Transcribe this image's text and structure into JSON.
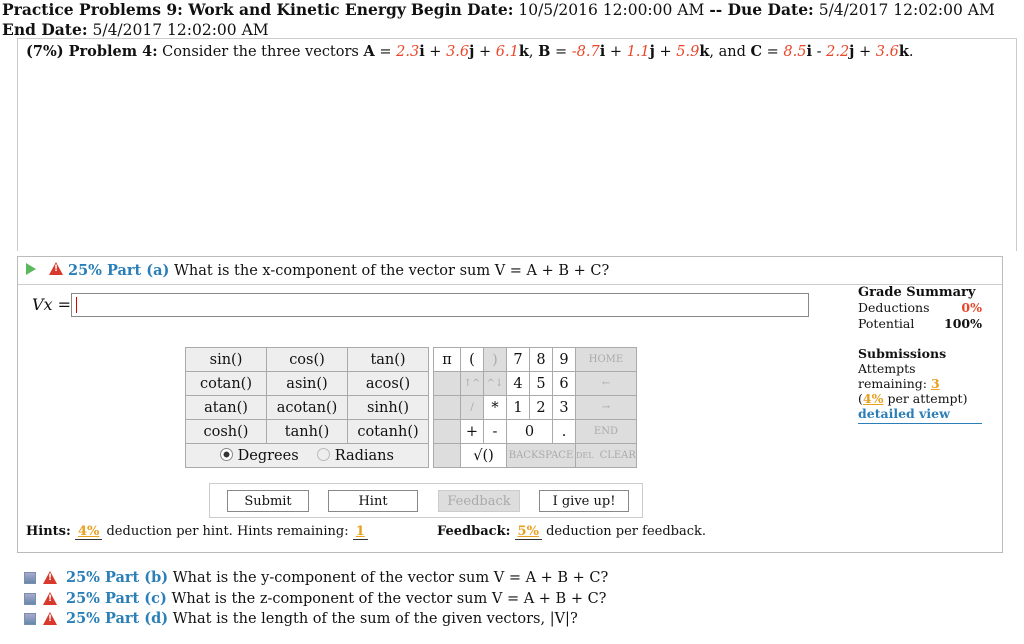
{
  "header": {
    "label": "Practice Problems 9: Work and Kinetic Energy",
    "begin_label": "Begin Date:",
    "begin": "10/5/2016 12:00:00 AM",
    "due_label": "-- Due Date:",
    "due": "5/4/2017 12:02:00 AM",
    "end_label": "End Date:",
    "end": "5/4/2017 12:02:00 AM"
  },
  "problem": {
    "label": "(7%) Problem 4:",
    "text_pre": "Consider the three vectors",
    "A": {
      "name": "A",
      "x": "2.3",
      "y": "3.6",
      "z": "6.1"
    },
    "B": {
      "name": "B",
      "x": "-8.7",
      "y": "1.1",
      "z": "5.9"
    },
    "C": {
      "name": "C",
      "x": "8.5",
      "y": "2.2",
      "z": "3.6"
    }
  },
  "part_a": {
    "label": "25% Part (a)",
    "question": "What is the x-component of the vector sum V = A + B + C?",
    "var_label": "Vx =",
    "answer_value": ""
  },
  "keypad": {
    "functions": [
      [
        "sin()",
        "cos()",
        "tan()"
      ],
      [
        "cotan()",
        "asin()",
        "acos()"
      ],
      [
        "atan()",
        "acotan()",
        "sinh()"
      ],
      [
        "cosh()",
        "tanh()",
        "cotanh()"
      ]
    ],
    "degrees": "Degrees",
    "radians": "Radians",
    "pi": "π",
    "open": "(",
    "close": ")",
    "nums": [
      [
        "7",
        "8",
        "9"
      ],
      [
        "4",
        "5",
        "6"
      ],
      [
        "1",
        "2",
        "3"
      ]
    ],
    "home": "HOME",
    "end": "END",
    "backspace": "BACKSPACE",
    "del": "DEL",
    "clear": "CLEAR",
    "zero": "0",
    "dot": ".",
    "plus": "+",
    "minus": "-",
    "times": "*",
    "divide": "/",
    "sqrt": "√()",
    "up": "↑^",
    "updown": "^↓",
    "left": "←",
    "right": "→"
  },
  "buttons": {
    "submit": "Submit",
    "hint": "Hint",
    "feedback": "Feedback",
    "giveup": "I give up!"
  },
  "hints": {
    "label": "Hints:",
    "pct": "4%",
    "text": "deduction per hint. Hints remaining:",
    "remaining": "1"
  },
  "feedback": {
    "label": "Feedback:",
    "pct": "5%",
    "text": "deduction per feedback."
  },
  "grade": {
    "title": "Grade Summary",
    "deductions_label": "Deductions",
    "deductions": "0%",
    "potential_label": "Potential",
    "potential": "100%",
    "submissions_title": "Submissions",
    "attempts_label": "Attempts remaining:",
    "attempts": "3",
    "per_attempt_pct": "4%",
    "per_attempt_text": "per attempt)",
    "detail": "detailed view"
  },
  "other_parts": [
    {
      "label": "25% Part (b)",
      "question": "What is the y-component of the vector sum V = A + B + C?"
    },
    {
      "label": "25% Part (c)",
      "question": "What is the z-component of the vector sum V = A + B + C?"
    },
    {
      "label": "25% Part (d)",
      "question": "What is the length of the sum of the given vectors, |V|?"
    }
  ],
  "colors": {
    "accent": "#2a7fb8",
    "red": "#e8472a",
    "warn": "#d9392b",
    "green": "#5cb85c"
  }
}
